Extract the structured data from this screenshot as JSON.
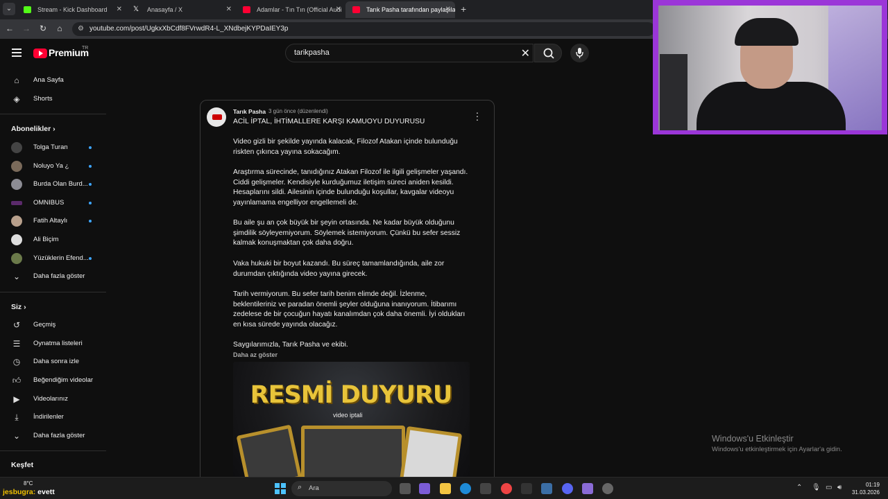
{
  "browser": {
    "tabs": [
      {
        "title": "Stream - Kick Dashboard",
        "favicon_color": "#53fc18"
      },
      {
        "title": "Anasayfa / X",
        "favicon_color": "#ffffff"
      },
      {
        "title": "Adamlar - Tın Tın (Official Audi",
        "favicon_color": "#ff0033"
      },
      {
        "title": "Tarık Pasha tarafından paylaşılan",
        "favicon_color": "#ff0033"
      }
    ],
    "url": "youtube.com/post/UgkxXbCdf8FVrwdR4-L_XNdbejKYPDaIEY3p"
  },
  "header": {
    "logo": "Premium",
    "logo_country": "TR",
    "search_query": "tarikpasha"
  },
  "sidebar": {
    "main": [
      {
        "label": "Ana Sayfa",
        "icon": "home-icon"
      },
      {
        "label": "Shorts",
        "icon": "shorts-icon"
      }
    ],
    "subs_title": "Abonelikler",
    "subs": [
      {
        "label": "Tolga Turan",
        "color": "#444444",
        "dot": true
      },
      {
        "label": "Noluyo Ya ¿",
        "color": "#7a6a5a",
        "dot": true
      },
      {
        "label": "Burda Olan Burd...",
        "color": "#8c8c94",
        "dot": true
      },
      {
        "label": "OMNIBUS",
        "color": "#5b2a6b",
        "dot": true
      },
      {
        "label": "Fatih Altaylı",
        "color": "#b8a08c",
        "dot": true
      },
      {
        "label": "Ali Biçim",
        "color": "#dddddd",
        "dot": false
      },
      {
        "label": "Yüzüklerin Efend...",
        "color": "#6b7a4a",
        "dot": true
      }
    ],
    "subs_more": "Daha fazla göster",
    "you_title": "Siz",
    "you": [
      {
        "label": "Geçmiş",
        "icon": "history-icon"
      },
      {
        "label": "Oynatma listeleri",
        "icon": "playlist-icon"
      },
      {
        "label": "Daha sonra izle",
        "icon": "clock-icon"
      },
      {
        "label": "Beğendiğim videolar",
        "icon": "thumb-up-icon"
      },
      {
        "label": "Videolarınız",
        "icon": "video-icon"
      },
      {
        "label": "İndirilenler",
        "icon": "download-icon"
      }
    ],
    "you_more": "Daha fazla göster",
    "explore_title": "Keşfet"
  },
  "post": {
    "author": "Tarık Pasha",
    "time": "3 gün önce (düzenlendi)",
    "title": "ACİL İPTAL, İHTİMALLERE KARŞI KAMUOYU DUYURUSU",
    "paragraphs": [
      "Video gizli bir şekilde yayında kalacak, Filozof Atakan içinde bulunduğu riskten çıkınca yayına sokacağım.",
      "Araştırma sürecinde, tanıdığınız Atakan Filozof ile ilgili gelişmeler yaşandı. Ciddi gelişmeler. Kendisiyle kurduğumuz iletişim süreci aniden kesildi. Hesaplarını sildi. Ailesinin içinde bulunduğu koşullar, kavgalar videoyu yayınlamama engelliyor engellemeli de.",
      "Bu aile şu an çok büyük bir şeyin ortasında. Ne kadar büyük olduğunu şimdilik söyleyemiyorum. Söylemek istemiyorum. Çünkü bu sefer sessiz kalmak konuşmaktan çok daha doğru.",
      "Vaka hukuki bir boyut kazandı. Bu süreç tamamlandığında, aile zor durumdan çıktığında video yayına girecek.",
      "Tarih vermiyorum. Bu sefer tarih benim elimde değil. İzlenme, beklentileriniz ve paradan önemli şeyler olduğuna inanıyorum. İtibarımı zedelese de bir çocuğun hayatı kanalımdan çok daha önemli. İyi oldukları en kısa sürede yayında olacağız.",
      "Saygılarımızla, Tarık Pasha ve ekibi."
    ],
    "show_less": "Daha az göster",
    "image_title": "RESMİ DUYURU",
    "image_subtitle": "video iptali"
  },
  "watermark": {
    "line1": "Windows'u Etkinleştir",
    "line2": "Windows'u etkinleştirmek için Ayarlar'a gidin."
  },
  "taskbar": {
    "weather": "8°C",
    "chat_user": "jesbugra:",
    "chat_msg": " evett",
    "search": "Ara",
    "time": "01:19",
    "date": "31.03.2026"
  }
}
